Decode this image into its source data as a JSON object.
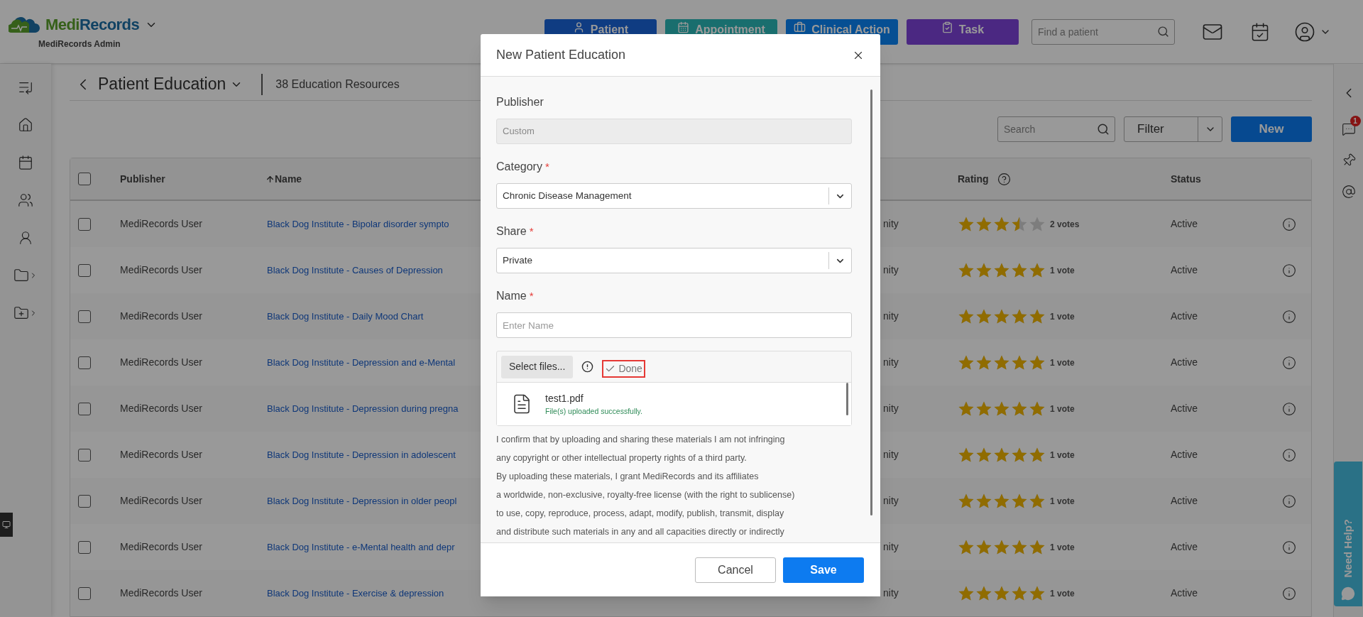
{
  "header": {
    "logo": {
      "part_1": "Medi",
      "part_2": "Records"
    },
    "account": "MediRecords Admin",
    "nav_buttons": [
      {
        "label": "Patient",
        "kind": "patient"
      },
      {
        "label": "Appointment",
        "kind": "appointment"
      },
      {
        "label": "Clinical Action",
        "kind": "clinical"
      },
      {
        "label": "Task",
        "kind": "task"
      }
    ],
    "search": {
      "placeholder": "Find a patient"
    }
  },
  "page": {
    "title": "Patient Education",
    "count": "38 Education Resources"
  },
  "toolbar": {
    "search": {
      "placeholder": "Search"
    },
    "filter": "Filter",
    "new": "New"
  },
  "table": {
    "header_checked": false,
    "columns": [
      "Publisher",
      "Name",
      "Rating",
      "Status"
    ],
    "rows": [
      {
        "checked": false,
        "publisher": "MediRecords User",
        "name": "Black Dog Institute - Bipolar disorder sympto",
        "column_5": "nity",
        "stars": 3.5,
        "votes": "2 votes",
        "status": "Active"
      },
      {
        "checked": false,
        "publisher": "MediRecords User",
        "name": "Black Dog Institute - Causes of Depression",
        "column_5": "nity",
        "stars": 5,
        "votes": "1 vote",
        "status": "Active"
      },
      {
        "checked": false,
        "publisher": "MediRecords User",
        "name": "Black Dog Institute - Daily Mood Chart",
        "column_5": "nity",
        "stars": 5,
        "votes": "1 vote",
        "status": "Active"
      },
      {
        "checked": false,
        "publisher": "MediRecords User",
        "name": "Black Dog Institute - Depression and e-Mental",
        "column_5": "nity",
        "stars": 5,
        "votes": "1 vote",
        "status": "Active"
      },
      {
        "checked": false,
        "publisher": "MediRecords User",
        "name": "Black Dog Institute - Depression during pregna",
        "column_5": "nity",
        "stars": 5,
        "votes": "1 vote",
        "status": "Active"
      },
      {
        "checked": false,
        "publisher": "MediRecords User",
        "name": "Black Dog Institute - Depression in adolescent",
        "column_5": "nity",
        "stars": 5,
        "votes": "1 vote",
        "status": "Active"
      },
      {
        "checked": false,
        "publisher": "MediRecords User",
        "name": "Black Dog Institute - Depression in older peopl",
        "column_5": "nity",
        "stars": 5,
        "votes": "1 vote",
        "status": "Active"
      },
      {
        "checked": false,
        "publisher": "MediRecords User",
        "name": "Black Dog Institute - e-Mental health and depr",
        "column_5": "nity",
        "stars": 5,
        "votes": "1 vote",
        "status": "Active"
      },
      {
        "checked": false,
        "publisher": "MediRecords User",
        "name": "Black Dog Institute - Exercise & depression",
        "column_5": "nity",
        "stars": 5,
        "votes": "1 vote",
        "status": "Active"
      }
    ]
  },
  "right_sidebar": {
    "chat_badge": "1",
    "help_tab": "Need Help?"
  },
  "modal": {
    "title": "New Patient Education",
    "fields": [
      {
        "kind": "readonly",
        "label": "Publisher",
        "required": false,
        "value": "Custom"
      },
      {
        "kind": "select",
        "label": "Category",
        "required": true,
        "value": "Chronic Disease Management"
      },
      {
        "kind": "select",
        "label": "Share",
        "required": true,
        "value": "Private"
      },
      {
        "kind": "text",
        "label": "Name",
        "required": true,
        "placeholder": "Enter Name"
      }
    ],
    "required_mark": "*",
    "upload": {
      "button": "Select files...",
      "status": "Done",
      "highlighted": true,
      "file": "test1.pdf",
      "message": "File(s) uploaded successfully."
    },
    "consent_lines": [
      "I confirm that by uploading and sharing these materials I am not infringing",
      "any copyright or other intellectual property rights of a third party.",
      "By uploading these materials, I grant MediRecords and its affiliates",
      "a worldwide, non-exclusive, royalty-free license (with the right to sublicense)",
      "to use, copy, reproduce, process, adapt, modify, publish, transmit, display",
      "and distribute such materials in any and all capacities directly or indirectly"
    ],
    "cancel": "Cancel",
    "save": "Save"
  }
}
